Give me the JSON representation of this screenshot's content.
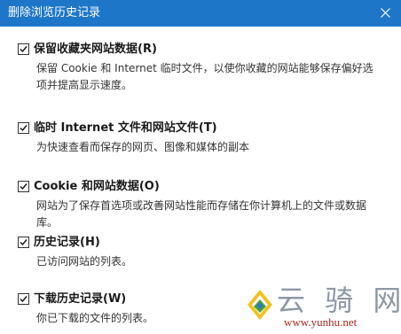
{
  "window": {
    "title": "删除浏览历史记录",
    "titlebar_color": "#1e76c8"
  },
  "options": [
    {
      "label": "保留收藏夹网站数据(R)",
      "checked": true,
      "description": "保留 Cookie 和 Internet 临时文件，以使你收藏的网站能够保存偏好选项并提高显示速度。"
    },
    {
      "label": "临时 Internet 文件和网站文件(T)",
      "checked": true,
      "description": "为快速查看而保存的网页、图像和媒体的副本"
    },
    {
      "label": "Cookie 和网站数据(O)",
      "checked": true,
      "description": "网站为了保存首选项或改善网站性能而存储在你计算机上的文件或数据库。"
    },
    {
      "label": "历史记录(H)",
      "checked": true,
      "description": "已访问网站的列表。"
    },
    {
      "label": "下载历史记录(W)",
      "checked": true,
      "description": "你已下载的文件的列表。"
    }
  ],
  "watermark": {
    "name": "云 骑 网",
    "url": "www.yunhu.net"
  }
}
